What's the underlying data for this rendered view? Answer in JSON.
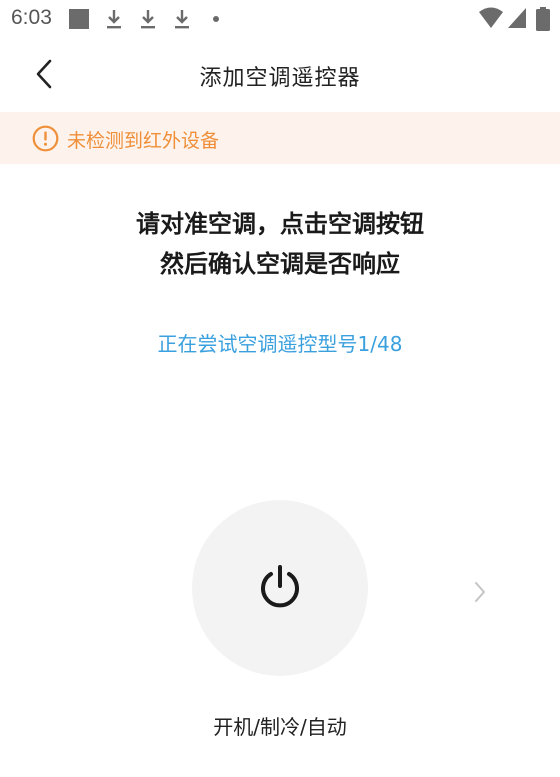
{
  "status_bar": {
    "time": "6:03",
    "icons": [
      "notification-square-icon",
      "download-icon",
      "download-icon",
      "download-icon",
      "more-dot-icon",
      "wifi-icon",
      "signal-icon",
      "battery-icon"
    ]
  },
  "header": {
    "title": "添加空调遥控器",
    "back_icon": "chevron-left-icon"
  },
  "banner": {
    "icon": "exclamation-circle-icon",
    "text": "未检测到红外设备",
    "color": "#ef8f3a",
    "background": "#fdf3ec"
  },
  "instructions": {
    "line1": "请对准空调，点击空调按钮",
    "line2": "然后确认空调是否响应"
  },
  "trying": {
    "text": "正在尝试空调遥控型号1/48",
    "color": "#3aa0de"
  },
  "power_button": {
    "icon": "power-icon",
    "label": "开机/制冷/自动"
  },
  "next_button": {
    "icon": "chevron-right-icon"
  }
}
